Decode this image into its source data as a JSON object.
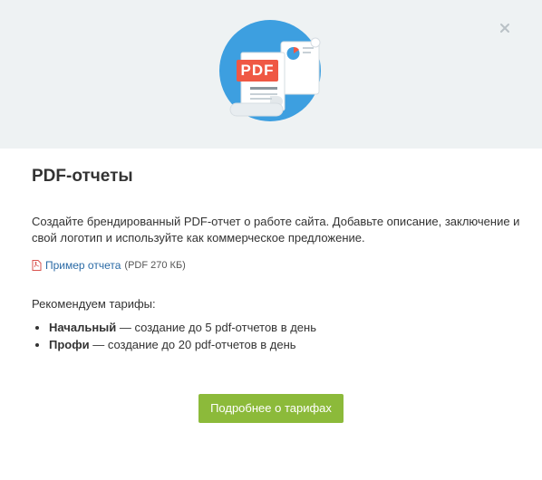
{
  "modal": {
    "close_icon": "close-icon",
    "illustration_icon": "pdf-report-illustration",
    "illustration_badge": "PDF",
    "title": "PDF-отчеты",
    "description": "Создайте брендированный PDF-отчет о работе сайта. Добавьте описание, заключение и свой логотип и используйте как коммерческое предложение.",
    "sample": {
      "icon": "pdf-file-icon",
      "link_label": "Пример отчета",
      "meta": "(PDF 270 КБ)"
    },
    "recommend_label": "Рекомендуем тарифы:",
    "plans": [
      {
        "name": "Начальный",
        "text": " — создание до 5 pdf-отчетов в день"
      },
      {
        "name": "Профи",
        "text": " — создание до 20 pdf-отчетов в день"
      }
    ],
    "cta_label": "Подробнее о тарифах"
  },
  "colors": {
    "hero_bg": "#eef2f3",
    "circle_blue": "#3d9fe0",
    "pdf_red": "#ef5844",
    "button_green": "#8cba3a",
    "link_blue": "#2a6aa5"
  }
}
